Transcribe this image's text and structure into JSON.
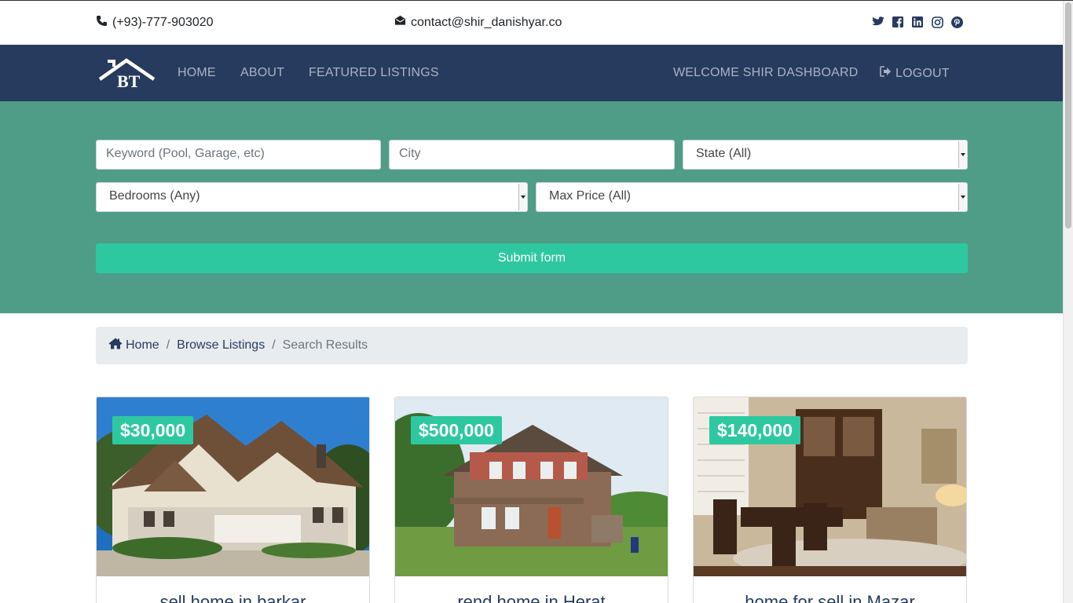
{
  "topbar": {
    "phone": "(+93)-777-903020",
    "email": "contact@shir_danishyar.co",
    "social_icons": [
      "twitter-icon",
      "facebook-icon",
      "linkedin-icon",
      "instagram-icon",
      "pinterest-icon"
    ]
  },
  "navbar": {
    "logo_text": "BT",
    "links": {
      "home": "HOME",
      "about": "ABOUT",
      "featured": "FEATURED LISTINGS"
    },
    "welcome": "WELCOME SHIR DASHBOARD",
    "logout": "LOGOUT"
  },
  "search": {
    "keyword_placeholder": "Keyword (Pool, Garage, etc)",
    "city_placeholder": "City",
    "state_selected": "State (All)",
    "bedrooms_selected": "Bedrooms (Any)",
    "max_price_selected": "Max Price (All)",
    "submit_label": "Submit form"
  },
  "breadcrumb": {
    "home": "Home",
    "browse": "Browse Listings",
    "current": "Search Results",
    "separator": "/"
  },
  "listings": [
    {
      "price": "$30,000",
      "title": "sell home in barkar"
    },
    {
      "price": "$500,000",
      "title": "rend home in Herat"
    },
    {
      "price": "$140,000",
      "title": "home for sell in Mazar"
    }
  ],
  "colors": {
    "navbar": "#273b5e",
    "search_bg": "#4f9d87",
    "accent": "#2ec8a0"
  }
}
